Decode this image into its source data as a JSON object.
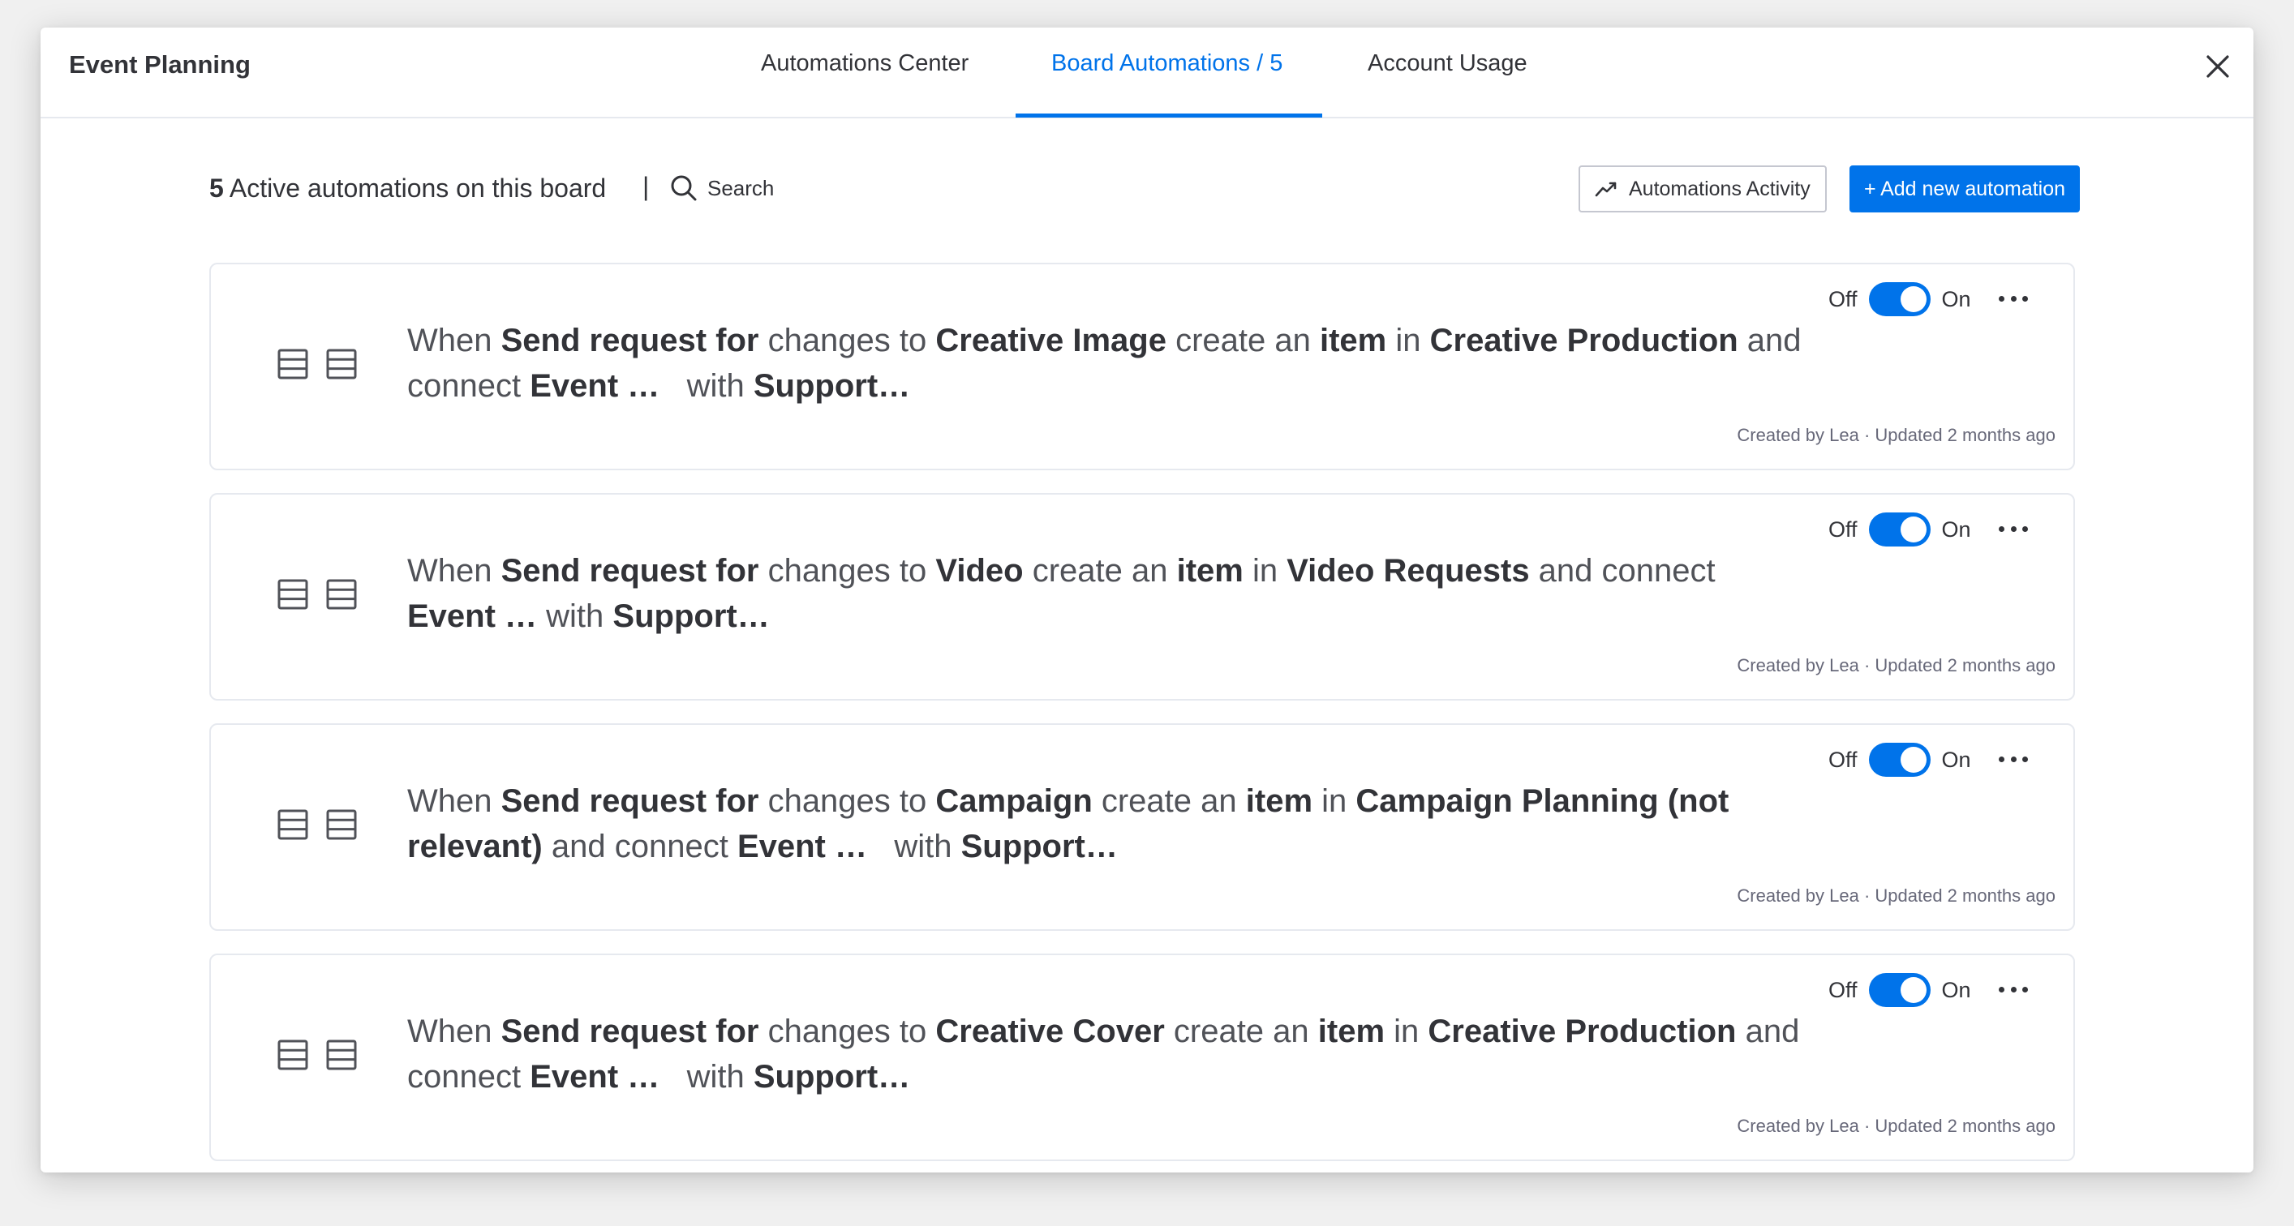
{
  "header": {
    "board_title": "Event Planning",
    "tabs": [
      {
        "label": "Automations Center",
        "active": false
      },
      {
        "label": "Board Automations / 5",
        "active": true
      },
      {
        "label": "Account Usage",
        "active": false
      }
    ]
  },
  "toolbar": {
    "count": "5",
    "count_suffix": " Active automations on this board",
    "separator": "|",
    "search_label": "Search",
    "activity_label": "Automations Activity",
    "add_label": "+ Add new automation"
  },
  "colors": {
    "accent": "#0073ea",
    "text": "#323338",
    "border": "#e6e9ef",
    "meta": "#676879"
  },
  "automations": [
    {
      "parts": [
        {
          "t": "When ",
          "b": false
        },
        {
          "t": "Send request for",
          "b": true
        },
        {
          "t": " changes to ",
          "b": false
        },
        {
          "t": "Creative Image",
          "b": true
        },
        {
          "t": " create an ",
          "b": false
        },
        {
          "t": "item",
          "b": true
        },
        {
          "t": " in ",
          "b": false
        },
        {
          "t": "Creative Production",
          "b": true
        },
        {
          "t": " and connect ",
          "b": false
        },
        {
          "t": "Event …",
          "b": true
        },
        {
          "t": "   with ",
          "b": false
        },
        {
          "t": "Support…",
          "b": true
        }
      ],
      "toggle_off": "Off",
      "toggle_on": "On",
      "enabled": true,
      "meta": "Created by Lea · Updated 2 months ago"
    },
    {
      "parts": [
        {
          "t": "When ",
          "b": false
        },
        {
          "t": "Send request for",
          "b": true
        },
        {
          "t": " changes to ",
          "b": false
        },
        {
          "t": "Video",
          "b": true
        },
        {
          "t": " create an ",
          "b": false
        },
        {
          "t": "item",
          "b": true
        },
        {
          "t": " in ",
          "b": false
        },
        {
          "t": "Video Requests",
          "b": true
        },
        {
          "t": " and connect ",
          "b": false
        },
        {
          "t": "Event …",
          "b": true
        },
        {
          "t": " with ",
          "b": false
        },
        {
          "t": "Support…",
          "b": true
        }
      ],
      "toggle_off": "Off",
      "toggle_on": "On",
      "enabled": true,
      "meta": "Created by Lea · Updated 2 months ago"
    },
    {
      "parts": [
        {
          "t": "When ",
          "b": false
        },
        {
          "t": "Send request for",
          "b": true
        },
        {
          "t": " changes to ",
          "b": false
        },
        {
          "t": "Campaign",
          "b": true
        },
        {
          "t": " create an ",
          "b": false
        },
        {
          "t": "item",
          "b": true
        },
        {
          "t": " in ",
          "b": false
        },
        {
          "t": "Campaign Planning (not relevant)",
          "b": true
        },
        {
          "t": " and connect ",
          "b": false
        },
        {
          "t": "Event …",
          "b": true
        },
        {
          "t": "   with ",
          "b": false
        },
        {
          "t": "Support…",
          "b": true
        }
      ],
      "toggle_off": "Off",
      "toggle_on": "On",
      "enabled": true,
      "meta": "Created by Lea · Updated 2 months ago"
    },
    {
      "parts": [
        {
          "t": "When ",
          "b": false
        },
        {
          "t": "Send request for",
          "b": true
        },
        {
          "t": " changes to ",
          "b": false
        },
        {
          "t": "Creative Cover",
          "b": true
        },
        {
          "t": " create an ",
          "b": false
        },
        {
          "t": "item",
          "b": true
        },
        {
          "t": " in ",
          "b": false
        },
        {
          "t": "Creative Production",
          "b": true
        },
        {
          "t": " and connect ",
          "b": false
        },
        {
          "t": "Event …",
          "b": true
        },
        {
          "t": "   with ",
          "b": false
        },
        {
          "t": "Support…",
          "b": true
        }
      ],
      "toggle_off": "Off",
      "toggle_on": "On",
      "enabled": true,
      "meta": "Created by Lea · Updated 2 months ago"
    }
  ]
}
